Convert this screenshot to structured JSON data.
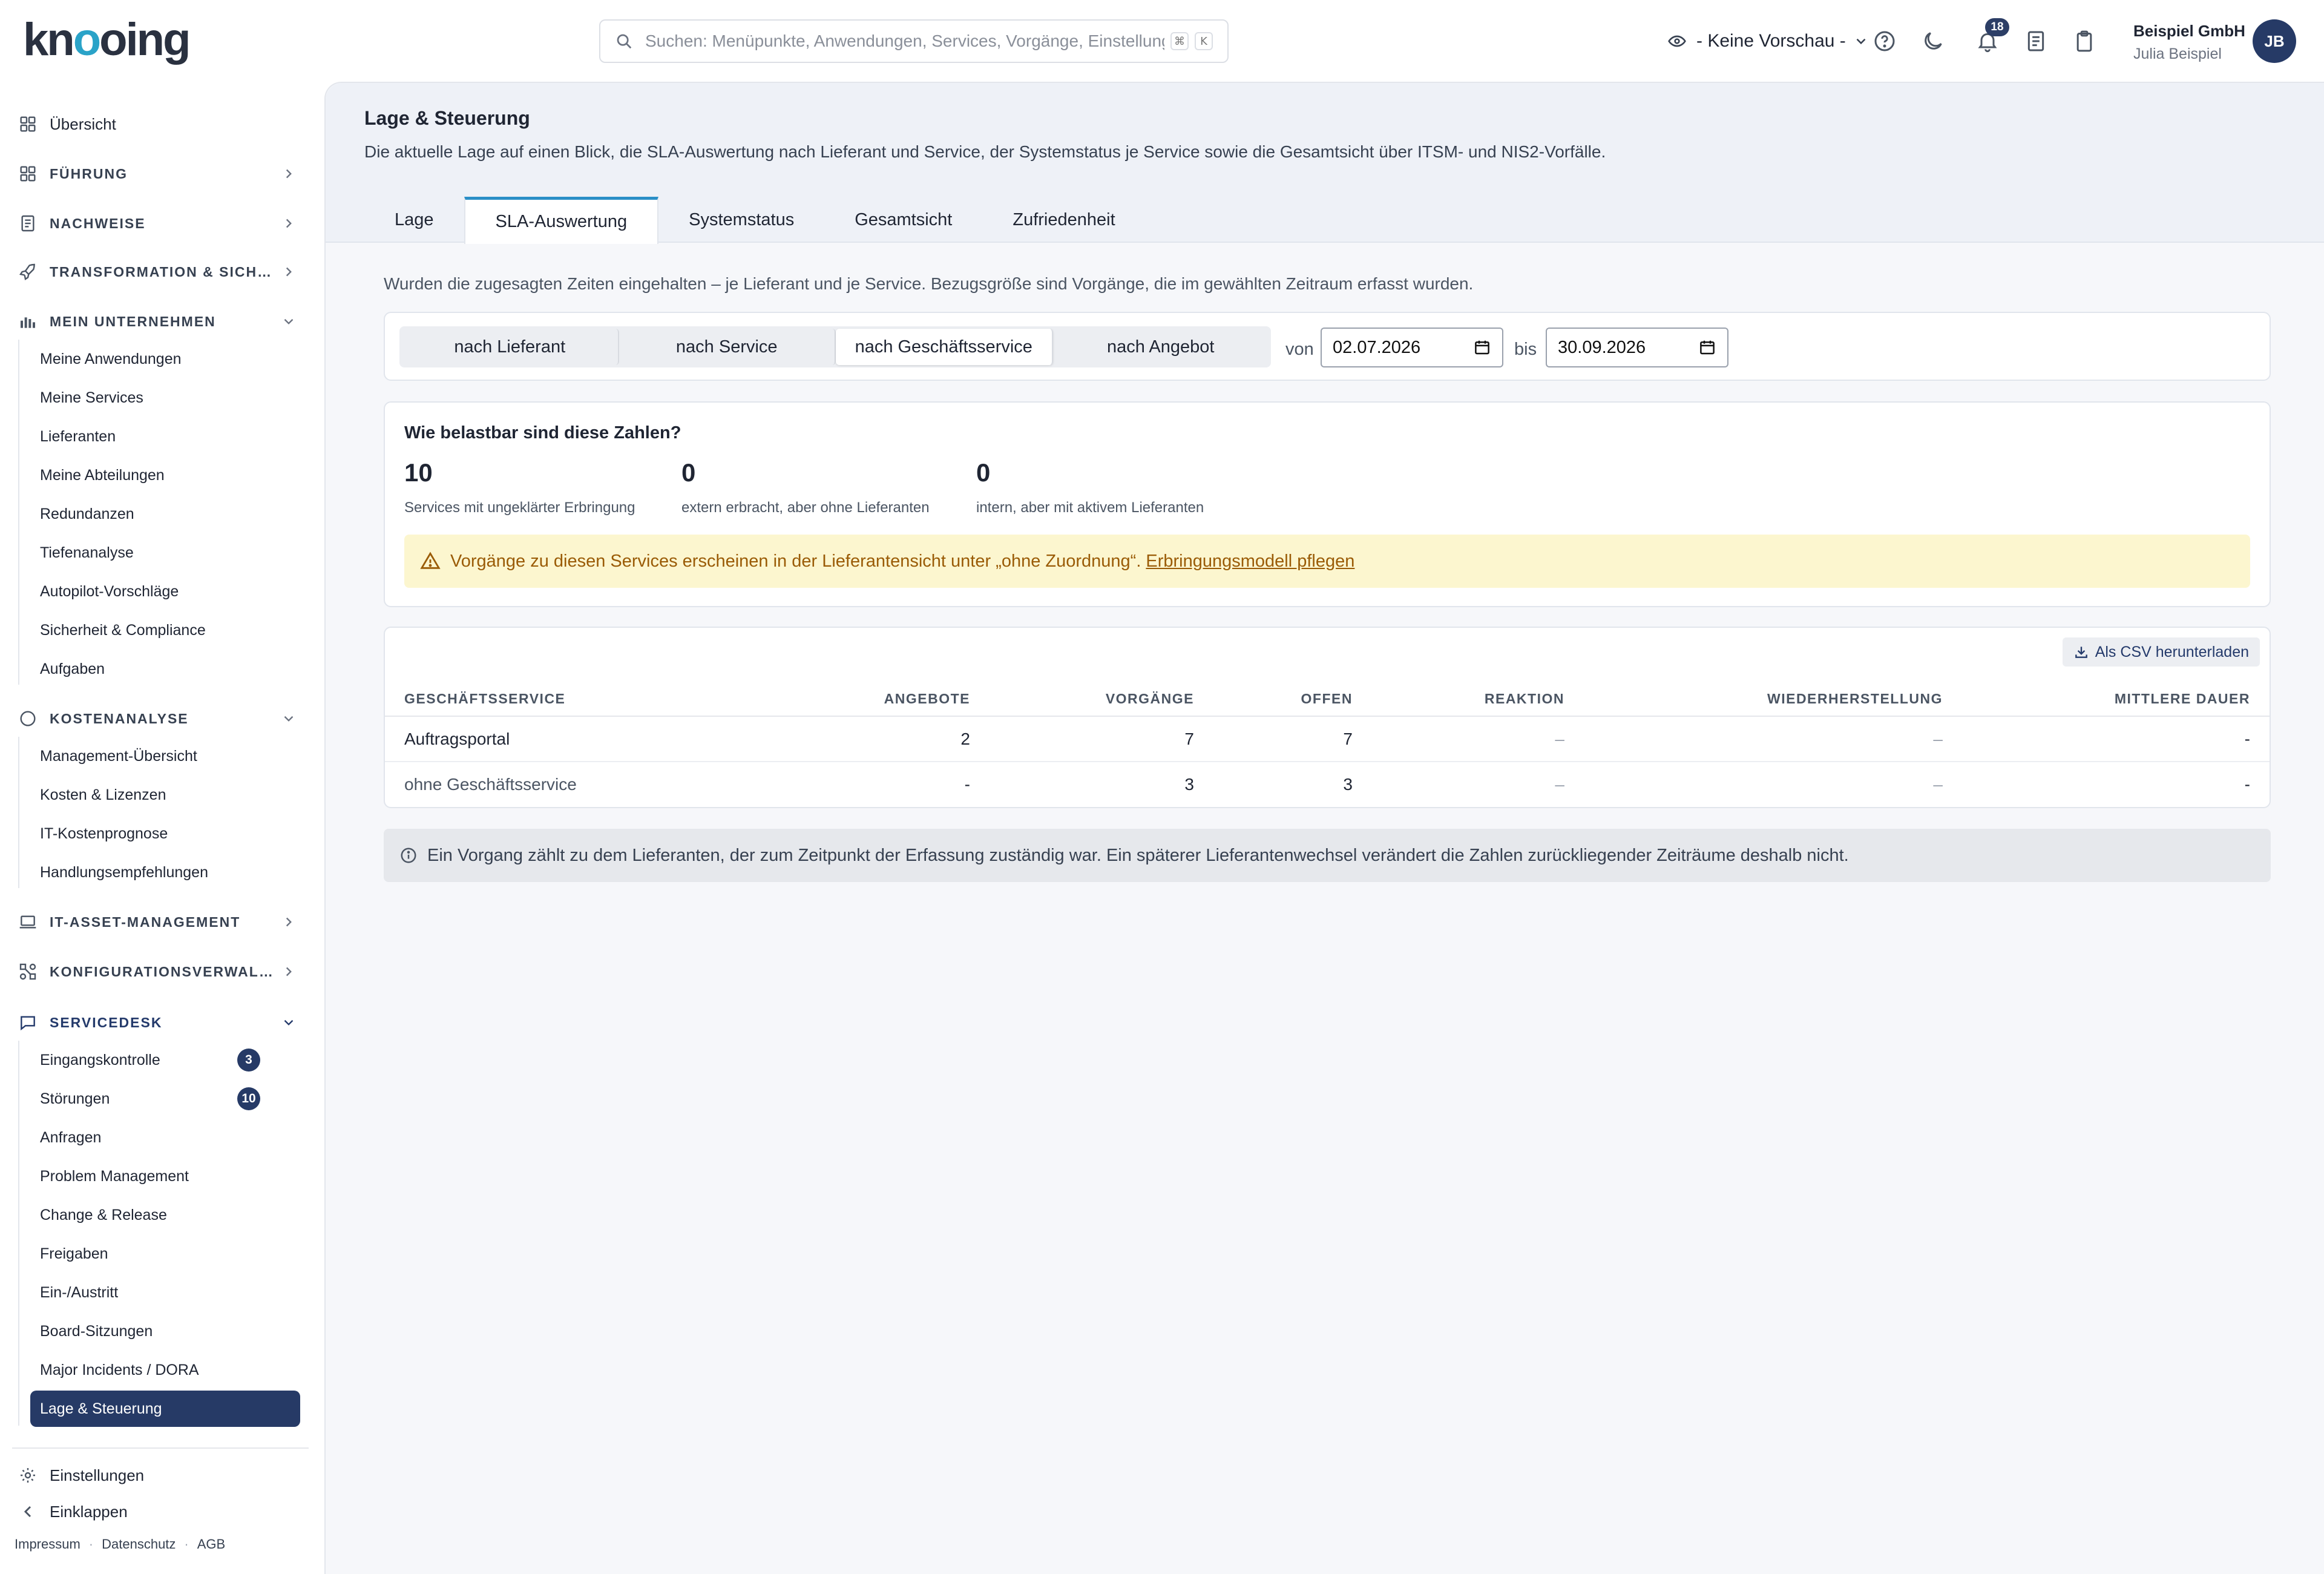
{
  "header": {
    "logo_pre": "kn",
    "logo_o": "o",
    "logo_post": "oing",
    "search_placeholder": "Suchen: Menüpunkte, Anwendungen, Services, Vorgänge, Einstellungen",
    "kbd_cmd": "⌘",
    "kbd_key": "K",
    "preview_label": "- Keine Vorschau -",
    "notification_count": "18",
    "org_name": "Beispiel GmbH",
    "user_name": "Julia Beispiel",
    "avatar_initials": "JB"
  },
  "sidebar": {
    "overview": "Übersicht",
    "fuehrung": "FÜHRUNG",
    "nachweise": "NACHWEISE",
    "transformation": "TRANSFORMATION & SICH…",
    "unternehmen": "MEIN UNTERNEHMEN",
    "unternehmen_items": [
      "Meine Anwendungen",
      "Meine Services",
      "Lieferanten",
      "Meine Abteilungen",
      "Redundanzen",
      "Tiefenanalyse",
      "Autopilot-Vorschläge",
      "Sicherheit & Compliance",
      "Aufgaben"
    ],
    "kosten": "KOSTENANALYSE",
    "kosten_items": [
      "Management-Übersicht",
      "Kosten & Lizenzen",
      "IT-Kostenprognose",
      "Handlungsempfehlungen"
    ],
    "itam": "IT-ASSET-MANAGEMENT",
    "konfig": "KONFIGURATIONSVERWAL…",
    "servicedesk": "SERVICEDESK",
    "servicedesk_items": [
      "Eingangskontrolle",
      "Störungen",
      "Anfragen",
      "Problem Management",
      "Change & Release",
      "Freigaben",
      "Ein-/Austritt",
      "Board-Sitzungen",
      "Major Incidents / DORA",
      "Lage & Steuerung"
    ],
    "eingangskontrolle_count": "3",
    "stoerungen_count": "10",
    "settings": "Einstellungen",
    "collapse": "Einklappen",
    "footer": [
      "Impressum",
      "Datenschutz",
      "AGB"
    ]
  },
  "page": {
    "title": "Lage & Steuerung",
    "description": "Die aktuelle Lage auf einen Blick, die SLA-Auswertung nach Lieferant und Service, der Systemstatus je Service sowie die Gesamtsicht über ITSM- und NIS2-Vorfälle.",
    "tabs": [
      "Lage",
      "SLA-Auswertung",
      "Systemstatus",
      "Gesamtsicht",
      "Zufriedenheit"
    ],
    "active_tab": "SLA-Auswertung",
    "intro": "Wurden die zugesagten Zeiten eingehalten – je Lieferant und je Service. Bezugsgröße sind Vorgänge, die im gewählten Zeitraum erfasst wurden."
  },
  "filters": {
    "segments": [
      "nach Lieferant",
      "nach Service",
      "nach Geschäftsservice",
      "nach Angebot"
    ],
    "active_segment": "nach Geschäftsservice",
    "from_label": "von",
    "from_value": "02.07.2026",
    "to_label": "bis",
    "to_value": "30.09.2026"
  },
  "reliability": {
    "title": "Wie belastbar sind diese Zahlen?",
    "metrics": [
      {
        "value": "10",
        "label": "Services mit ungeklärter Erbringung"
      },
      {
        "value": "0",
        "label": "extern erbracht, aber ohne Lieferanten"
      },
      {
        "value": "0",
        "label": "intern, aber mit aktivem Lieferanten"
      }
    ],
    "warning_text": "Vorgänge zu diesen Services erscheinen in der Lieferantensicht unter „ohne Zuordnung“.",
    "warning_link": "Erbringungsmodell pflegen"
  },
  "table": {
    "csv_button": "Als CSV herunterladen",
    "columns": [
      "GESCHÄFTSSERVICE",
      "ANGEBOTE",
      "VORGÄNGE",
      "OFFEN",
      "REAKTION",
      "WIEDERHERSTELLUNG",
      "MITTLERE DAUER"
    ],
    "rows": [
      [
        "Auftragsportal",
        "2",
        "7",
        "7",
        "–",
        "–",
        "-"
      ],
      [
        "ohne Geschäftsservice",
        "-",
        "3",
        "3",
        "–",
        "–",
        "-"
      ]
    ]
  },
  "info_note": "Ein Vorgang zählt zu dem Lieferanten, der zum Zeitpunkt der Erfassung zuständig war. Ein späterer Lieferantenwechsel verändert die Zahlen zurückliegender Zeiträume deshalb nicht.",
  "colors": {
    "brand": "#263a66",
    "accent": "#2a8fc7",
    "warning_bg": "#fcf6cf",
    "warning_text": "#9a5b06"
  }
}
